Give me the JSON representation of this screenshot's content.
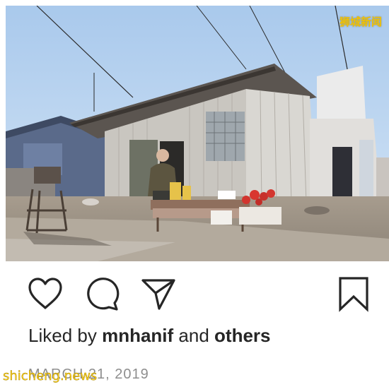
{
  "post": {
    "photo_alt": "Elderly man selling goods at a table outside corrugated metal shacks",
    "watermark_top": "狮城新闻",
    "actions": {
      "like": "heart-icon",
      "comment": "comment-icon",
      "share": "paper-plane-icon",
      "save": "bookmark-icon"
    },
    "likes": {
      "prefix": "Liked by",
      "user": "mnhanif",
      "conjunction": "and",
      "others": "others"
    },
    "date": "MARCH 21, 2019",
    "watermark_bottom": "shicheng.news"
  },
  "colors": {
    "text": "#262626",
    "muted": "#8e8e8e",
    "watermark": "#f2c200"
  }
}
